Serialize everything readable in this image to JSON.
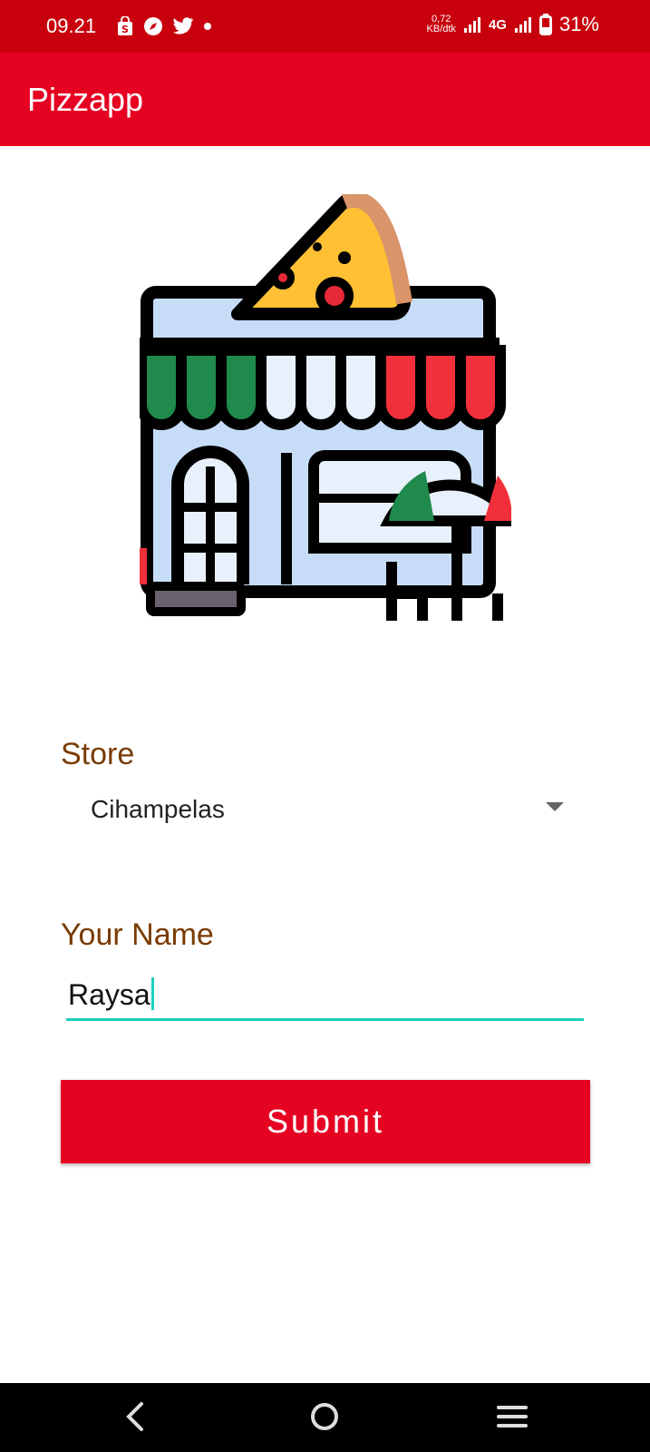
{
  "status_bar": {
    "time": "09.21",
    "net_speed_value": "0,72",
    "net_speed_unit": "KB/dtk",
    "network_type": "4G",
    "battery": "31%",
    "icons": [
      "shop-icon",
      "compass-icon",
      "twitter-icon",
      "dot-icon",
      "signal-icon",
      "signal-icon",
      "battery-icon"
    ]
  },
  "app_bar": {
    "title": "Pizzapp"
  },
  "hero": {
    "icon": "pizza-store-icon"
  },
  "form": {
    "store_label": "Store",
    "store_value": "Cihampelas",
    "name_label": "Your Name",
    "name_value": "Raysa",
    "submit_label": "Submit"
  },
  "colors": {
    "primary": "#e60322",
    "status_bar": "#c8000d",
    "label": "#7a3b00",
    "accent": "#1ccfc0"
  },
  "nav_bar": {
    "icons": [
      "back-icon",
      "home-icon",
      "menu-icon"
    ]
  }
}
